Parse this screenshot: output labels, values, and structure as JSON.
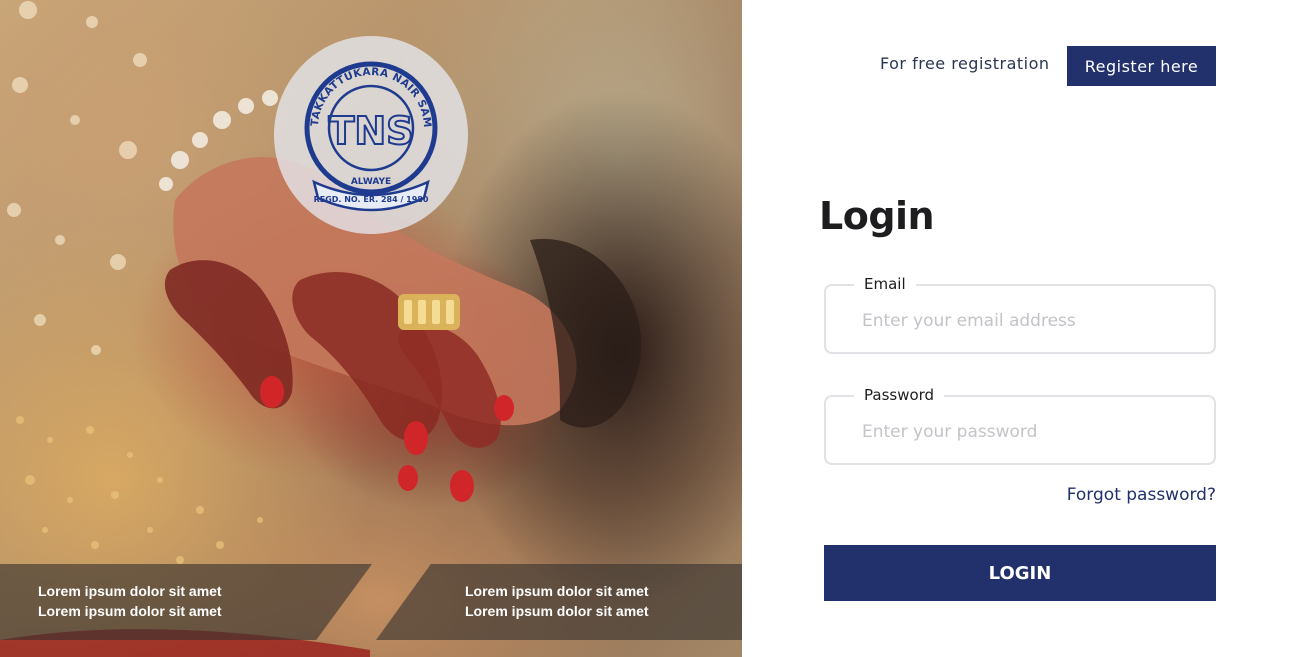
{
  "hero": {
    "seal": {
      "initials": "TNS",
      "ring_text": "THOTTAKKATTUKARA NAIR SAMAJAM",
      "place": "ALWAYE",
      "regd": "REGD. NO. ER. 284 / 1980"
    },
    "band_left": [
      "Lorem ipsum dolor sit amet",
      "Lorem ipsum dolor sit amet"
    ],
    "band_right": [
      "Lorem ipsum dolor sit amet",
      "Lorem ipsum dolor sit amet"
    ]
  },
  "topbar": {
    "registration_text": "For free registration",
    "register_button": "Register here"
  },
  "login": {
    "title": "Login",
    "email_label": "Email",
    "email_placeholder": "Enter your email address",
    "password_label": "Password",
    "password_placeholder": "Enter your password",
    "forgot_link": "Forgot password?",
    "submit_button": "LOGIN"
  },
  "colors": {
    "brand_navy": "#22306b",
    "text_dark": "#1d1d1f",
    "field_border": "#e2e2e6",
    "placeholder": "#c3c3c8"
  },
  "icons": [
    "tns-seal-logo"
  ]
}
